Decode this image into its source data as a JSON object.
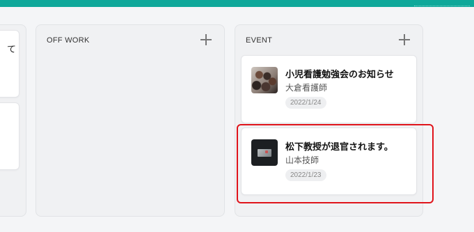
{
  "columns": {
    "left": {
      "snippet": "て"
    },
    "offwork": {
      "title": "OFF WORK"
    },
    "event": {
      "title": "EVENT",
      "cards": [
        {
          "title": "小児看護勉強会のお知らせ",
          "author": "大倉看護師",
          "date": "2022/1/24"
        },
        {
          "title": "松下教授が退官されます。",
          "author": "山本技師",
          "date": "2022/1/23"
        }
      ]
    }
  },
  "colors": {
    "top_bar": "#0fa89a",
    "highlight": "#e0141b"
  }
}
